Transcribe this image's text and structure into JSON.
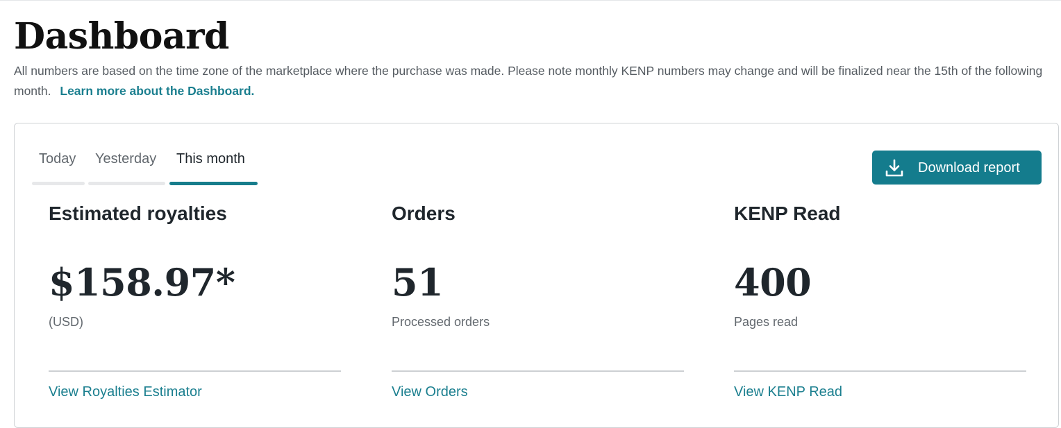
{
  "page": {
    "title": "Dashboard",
    "intro_text": "All numbers are based on the time zone of the marketplace where the purchase was made. Please note monthly KENP numbers may change and will be finalized near the 15th of the following month.",
    "intro_link": "Learn more about the Dashboard."
  },
  "tabs": [
    {
      "label": "Today",
      "active": false
    },
    {
      "label": "Yesterday",
      "active": false
    },
    {
      "label": "This month",
      "active": true
    }
  ],
  "toolbar": {
    "download_label": "Download report",
    "download_icon": "download-icon"
  },
  "metrics": [
    {
      "title": "Estimated royalties",
      "value": "$158.97*",
      "sub": "(USD)",
      "link": "View Royalties Estimator"
    },
    {
      "title": "Orders",
      "value": "51",
      "sub": "Processed orders",
      "link": "View Orders"
    },
    {
      "title": "KENP Read",
      "value": "400",
      "sub": "Pages read",
      "link": "View KENP Read"
    }
  ],
  "colors": {
    "accent": "#147c8d",
    "link": "#1b7f8f",
    "text": "#1f262c",
    "muted": "#62686e"
  }
}
